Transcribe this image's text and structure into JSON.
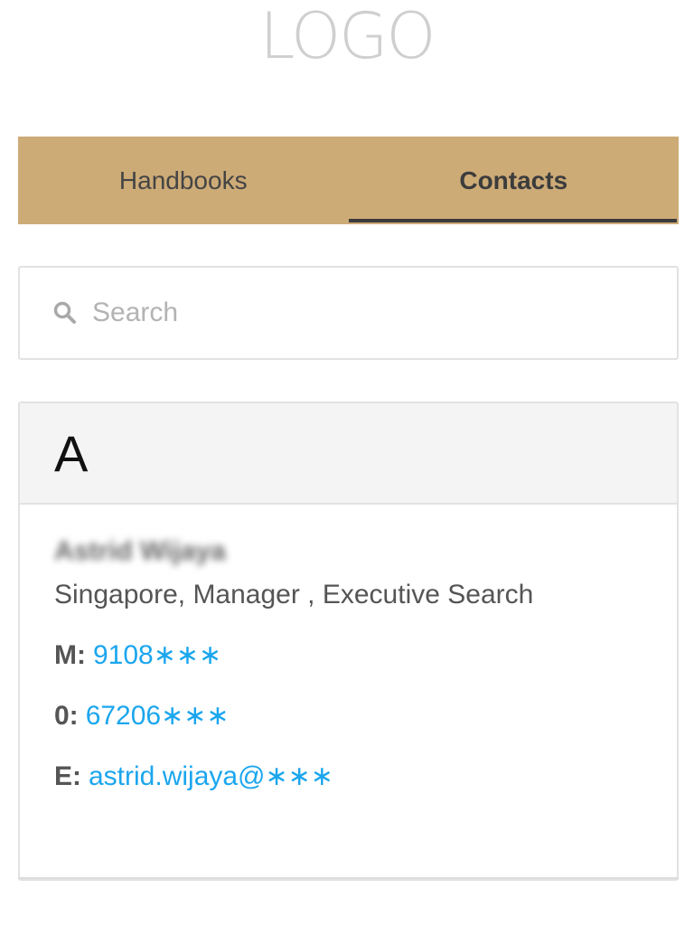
{
  "header": {
    "logo_text": "LOGO"
  },
  "tabs": [
    {
      "label": "Handbooks",
      "active": false
    },
    {
      "label": "Contacts",
      "active": true
    }
  ],
  "search": {
    "placeholder": "Search",
    "value": "",
    "icon": "search-icon"
  },
  "contacts_section": {
    "letter": "A",
    "contacts": [
      {
        "name": "Astrid Wijaya",
        "role": "Singapore, Manager , Executive Search",
        "mobile_label": "M:",
        "mobile": "9108∗∗∗",
        "office_label": "0:",
        "office": "67206∗∗∗",
        "email_label": "E:",
        "email": "astrid.wijaya@∗∗∗"
      }
    ]
  },
  "colors": {
    "tab_bar": "#cdab77",
    "link": "#1ba6ee",
    "section_header_bg": "#f4f4f4",
    "logo": "#cfcfcf"
  }
}
